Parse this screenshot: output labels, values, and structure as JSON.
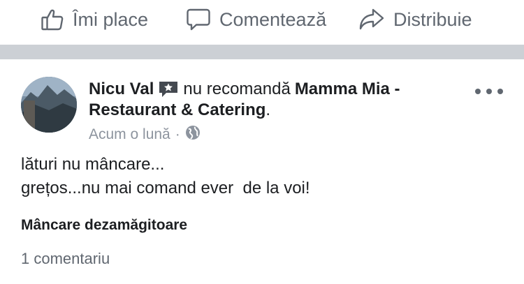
{
  "actions": {
    "like_label": "Îmi place",
    "comment_label": "Comentează",
    "share_label": "Distribuie"
  },
  "post": {
    "author": "Nicu Val",
    "verb": "nu recomandă",
    "page_name_part1": "Mamma Mia -",
    "page_name_part2": "Restaurant & Catering",
    "page_name_suffix": ".",
    "time": "Acum o lună",
    "separator": "·",
    "body_line1": "lături nu mâncare...",
    "body_line2": "grețos...nu mai comand ever  de la voi!",
    "tag": "Mâncare dezamăgitoare",
    "comments_count": "1 comentariu"
  },
  "colors": {
    "divider": "#ccd0d5",
    "action_text": "#606770",
    "meta_text": "#8d949e"
  },
  "icons": {
    "like": "thumbs-up-icon",
    "comment": "comment-bubble-icon",
    "share": "share-arrow-icon",
    "recommend": "star-speech-bubble-icon",
    "audience": "globe-icon",
    "more": "more-dots-icon"
  }
}
